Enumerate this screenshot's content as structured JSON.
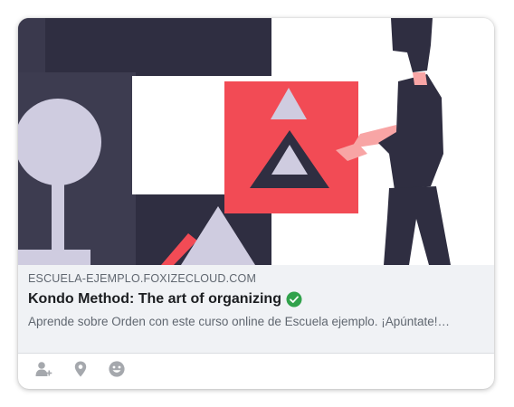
{
  "link_preview": {
    "domain": "ESCUELA-EJEMPLO.FOXIZECLOUD.COM",
    "title": "Kondo Method: The art of organizing",
    "description": "Aprende sobre Orden con este curso online de Escuela ejemplo. ¡Apúntate!…",
    "verified_icon": "verified-check-icon",
    "verified_color": "#31a24c"
  },
  "actions": [
    {
      "icon": "tag-person-icon"
    },
    {
      "icon": "location-pin-icon"
    },
    {
      "icon": "emoji-icon"
    }
  ],
  "colors": {
    "illustration_dark": "#2f2e41",
    "illustration_accent": "#f24b55",
    "illustration_light": "#cfcce0",
    "panel_background": "#f0f2f5"
  }
}
